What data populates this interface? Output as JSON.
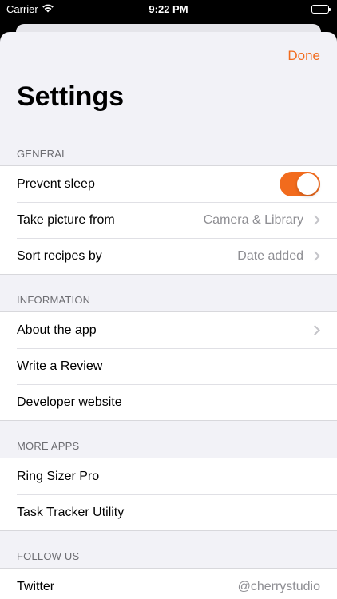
{
  "status_bar": {
    "carrier": "Carrier",
    "time": "9:22 PM"
  },
  "header": {
    "done_label": "Done",
    "title": "Settings"
  },
  "accent_color": "#f26b1d",
  "sections": {
    "general": {
      "title": "GENERAL",
      "prevent_sleep": {
        "label": "Prevent sleep",
        "toggle_on": true
      },
      "take_picture": {
        "label": "Take picture from",
        "value": "Camera & Library"
      },
      "sort_recipes": {
        "label": "Sort recipes by",
        "value": "Date added"
      }
    },
    "information": {
      "title": "INFORMATION",
      "about": {
        "label": "About the app"
      },
      "review": {
        "label": "Write a Review"
      },
      "website": {
        "label": "Developer website"
      }
    },
    "more_apps": {
      "title": "MORE APPS",
      "ring_sizer": {
        "label": "Ring Sizer Pro"
      },
      "task_tracker": {
        "label": "Task Tracker Utility"
      }
    },
    "follow_us": {
      "title": "FOLLOW US",
      "twitter": {
        "label": "Twitter",
        "value": "@cherrystudio"
      }
    }
  }
}
